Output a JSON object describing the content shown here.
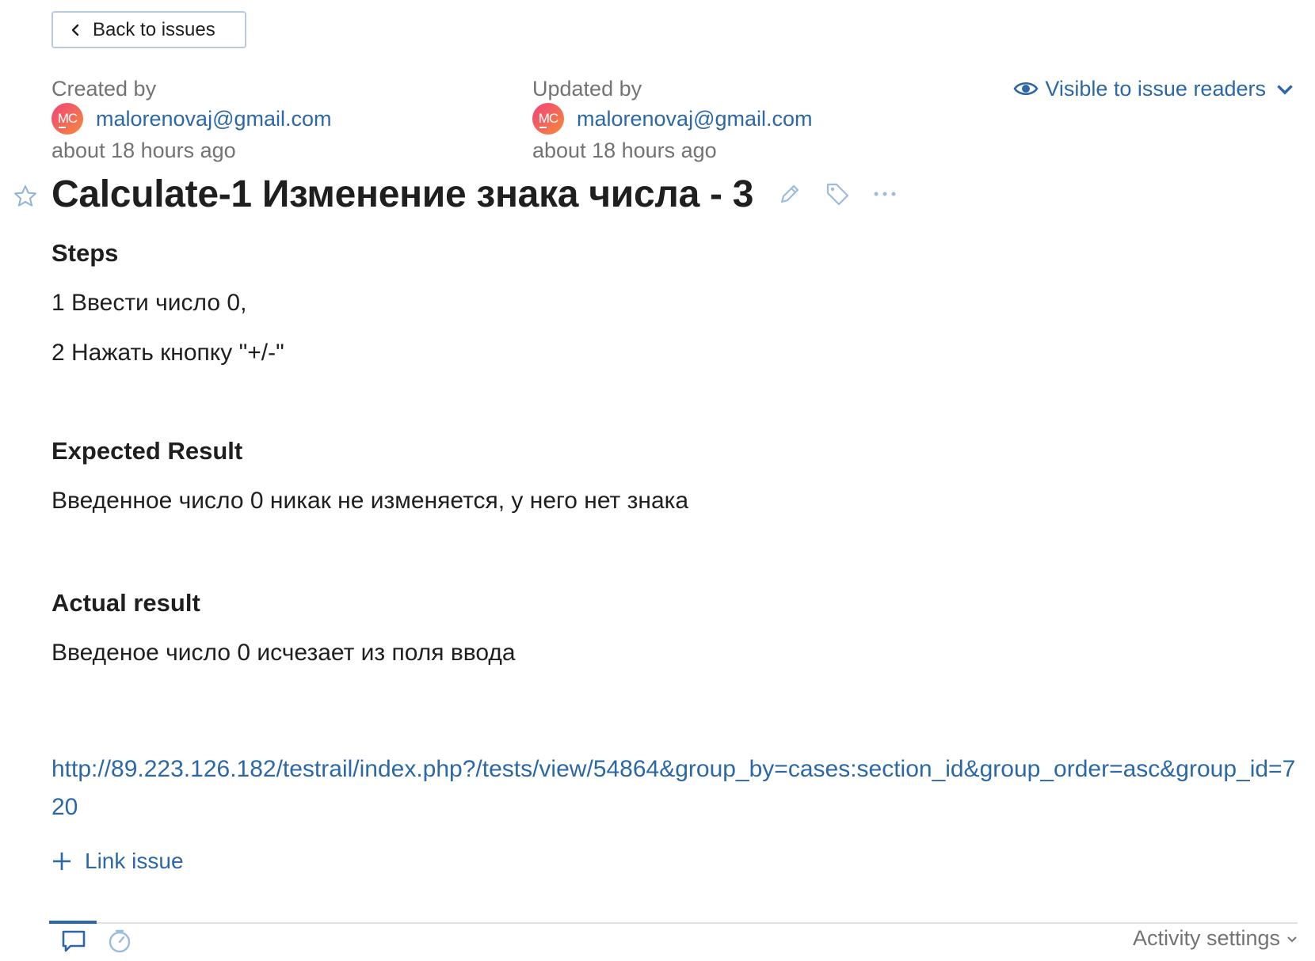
{
  "back_button": {
    "label": "Back to issues"
  },
  "created": {
    "label": "Created by",
    "avatar_initials": "MC",
    "user": "malorenovaj@gmail.com",
    "time": "about 18 hours ago"
  },
  "updated": {
    "label": "Updated by",
    "avatar_initials": "MC",
    "user": "malorenovaj@gmail.com",
    "time": "about 18 hours ago"
  },
  "visibility": {
    "label": "Visible to issue readers",
    "icon": "eye-icon"
  },
  "issue": {
    "title": "Calculate-1 Изменение знака числа - 3",
    "icons": [
      "star-icon",
      "pencil-icon",
      "tag-icon",
      "more-icon"
    ]
  },
  "description": {
    "steps_heading": "Steps",
    "step_1": "1 Ввести число 0,",
    "step_2": "2 Нажать кнопку \"+/-\"",
    "expected_heading": "Expected Result",
    "expected_text": "Введенное число 0 никак не изменяется, у него нет знака",
    "actual_heading": "Actual result",
    "actual_text": "Введеное число 0 исчезает из поля ввода",
    "url": "http://89.223.126.182/testrail/index.php?/tests/view/54864&group_by=cases:section_id&group_order=asc&group_id=720"
  },
  "link_issue": {
    "label": "Link issue",
    "icon": "plus-icon"
  },
  "activity": {
    "tabs": [
      "comments-icon",
      "history-icon"
    ],
    "active_tab": "comments-icon",
    "settings_label": "Activity settings"
  },
  "colors": {
    "link": "#2c68a8",
    "muted": "#737373",
    "text": "#1f1f1f"
  }
}
